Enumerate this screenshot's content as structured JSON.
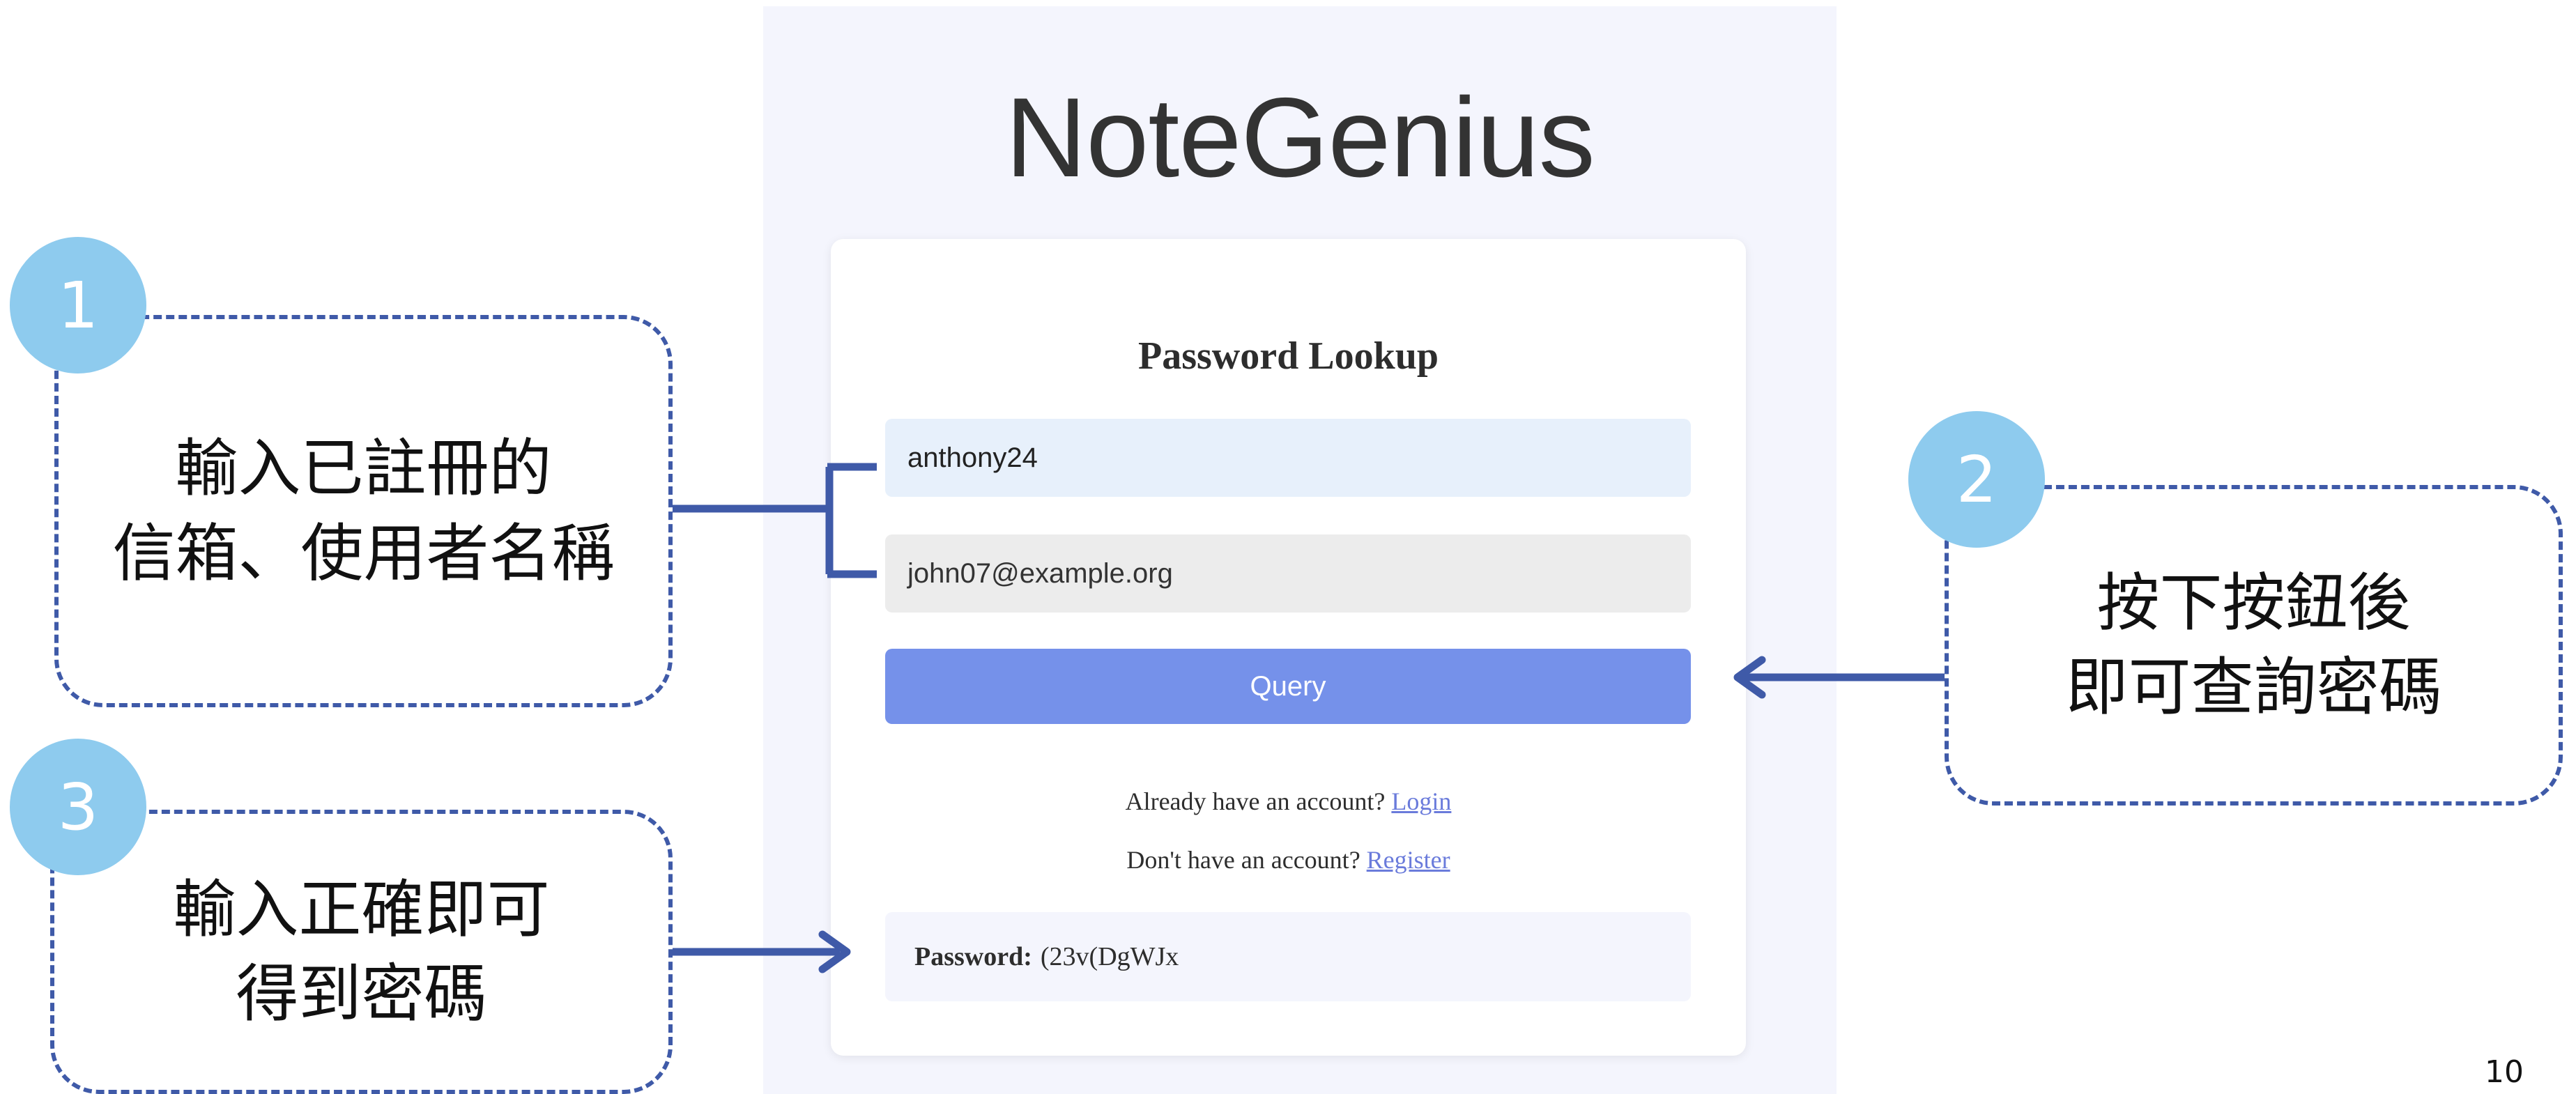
{
  "app": {
    "logo": "NoteGenius",
    "card_title": "Password Lookup",
    "username_value": "anthony24",
    "email_value": "john07@example.org",
    "query_label": "Query",
    "login_prompt": "Already have an account?",
    "login_link": "Login",
    "register_prompt": "Don't have an account?",
    "register_link": "Register",
    "result_label": "Password:",
    "result_value": "(23v(DgWJx"
  },
  "annotations": {
    "step1": {
      "number": "1",
      "lines": [
        "輸入已註冊的",
        "信箱、使用者名稱"
      ]
    },
    "step2": {
      "number": "2",
      "lines": [
        "按下按鈕後",
        "即可查詢密碼"
      ]
    },
    "step3": {
      "number": "3",
      "lines": [
        "輸入正確即可",
        "得到密碼"
      ]
    }
  },
  "page_number": "10",
  "colors": {
    "panel_bg": "#f4f5fd",
    "button_bg": "#7591ea",
    "callout_border": "#3f5aa8",
    "step_circle": "#8ecbee"
  }
}
